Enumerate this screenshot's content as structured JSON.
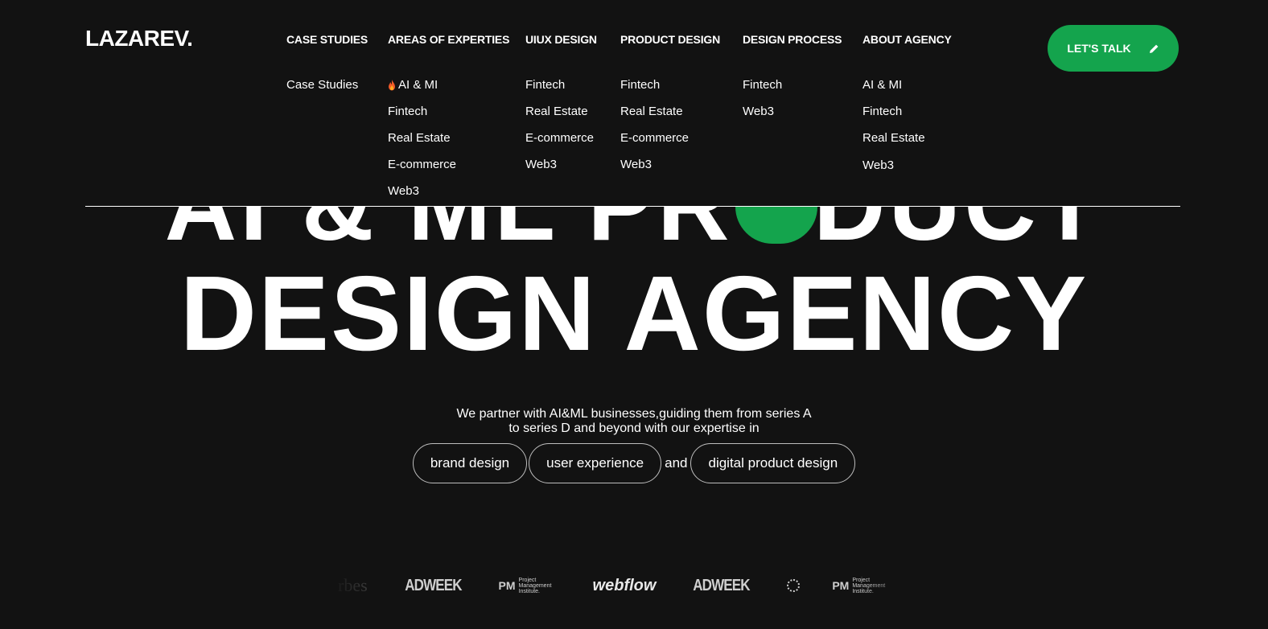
{
  "brand": {
    "name": "LAZAREV.",
    "accent": "#14a44d"
  },
  "nav": [
    {
      "label": "CASE STUDIES",
      "items": [
        "Case Studies"
      ]
    },
    {
      "label": "AREAS OF EXPERTIES",
      "items": [
        "AI & MI",
        "Fintech",
        "Real Estate",
        "E-commerce",
        "Web3"
      ]
    },
    {
      "label": "UIUX DESIGN",
      "items": [
        "Fintech",
        "Real Estate",
        "E-commerce",
        "Web3"
      ]
    },
    {
      "label": "PRODUCT DESIGN",
      "items": [
        "Fintech",
        "Real Estate",
        "E-commerce",
        "Web3"
      ]
    },
    {
      "label": "DESIGN PROCESS",
      "items": [
        "Fintech",
        "Web3"
      ]
    },
    {
      "label": "ABOUT AGENCY",
      "items": [
        "AI & MI",
        "Fintech",
        "Real Estate",
        "Web3"
      ]
    }
  ],
  "cta": {
    "label": "LET'S TALK",
    "icon": "pencil-icon"
  },
  "hero": {
    "line1": "AI & ML PRODUCT",
    "line2": "DESIGN AGENCY",
    "tagline_1": "We partner with AI&ML businesses,guiding them from series A",
    "tagline_2": "to series D and beyond with our expertise in",
    "pills": [
      "brand design",
      "user experience",
      "digital product design"
    ],
    "connector": "and"
  },
  "press": {
    "forbes": "rbes",
    "adweek": "ADWEEK",
    "pmi_mark": "PM",
    "pmi_text": "Project Management Institute.",
    "webflow": "webflow"
  }
}
